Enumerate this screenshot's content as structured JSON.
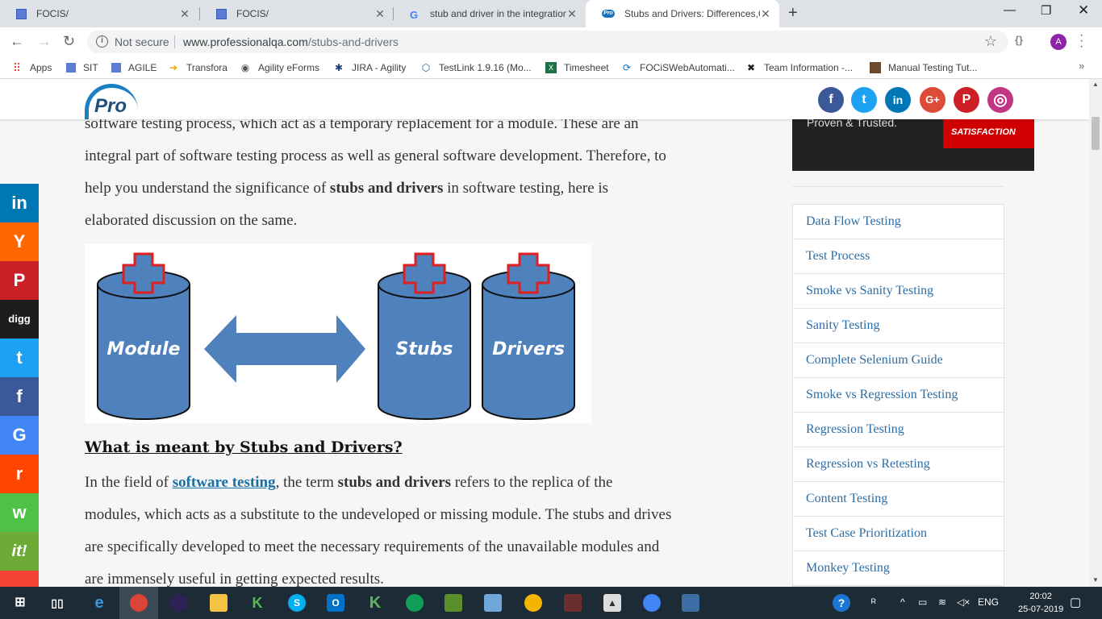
{
  "browser": {
    "tabs": [
      {
        "title": "FOCIS/",
        "icon": "doc-icon"
      },
      {
        "title": "FOCIS/",
        "icon": "doc-icon"
      },
      {
        "title": "stub and driver in the integration",
        "icon": "google-icon"
      },
      {
        "title": "Stubs and Drivers: Differences,Co",
        "icon": "pro-icon"
      }
    ],
    "address": {
      "security": "Not secure",
      "host": "www.professionalqa.com",
      "path": "/stubs-and-drivers"
    },
    "profile_initial": "A",
    "bookmarks": [
      {
        "label": "Apps",
        "icon": "apps-grid-icon",
        "color": "#e8453c"
      },
      {
        "label": "SIT",
        "icon": "doc-icon",
        "color": "#5b7bd5"
      },
      {
        "label": "AGILE",
        "icon": "doc-icon",
        "color": "#5b7bd5"
      },
      {
        "label": "Transfora",
        "icon": "transfora-icon",
        "color": "#f2a900"
      },
      {
        "label": "Agility eForms",
        "icon": "globe-icon",
        "color": "#555555"
      },
      {
        "label": "JIRA - Agility",
        "icon": "jira-icon",
        "color": "#1d3f72"
      },
      {
        "label": "TestLink 1.9.16 (Mo...",
        "icon": "testlink-icon",
        "color": "#2b5797"
      },
      {
        "label": "Timesheet",
        "icon": "sheet-icon",
        "color": "#1e7145"
      },
      {
        "label": "FOCiSWebAutomati...",
        "icon": "sync-icon",
        "color": "#0078d7"
      },
      {
        "label": "Team Information -...",
        "icon": "x-icon",
        "color": "#222222"
      },
      {
        "label": "Manual Testing Tut...",
        "icon": "cube-icon",
        "color": "#6b4a2b"
      }
    ]
  },
  "page": {
    "para1_line1": "software testing process, which act as a temporary replacement for a module. These are an",
    "para1_line2": "integral part of software testing process as well as general software development. Therefore, to",
    "para1_line3_pre": "help you understand the significance of ",
    "para1_line3_bold": "stubs and drivers",
    "para1_line3_post": " in software testing, here is",
    "para1_line4": "elaborated discussion on the same.",
    "figure": {
      "module_label": "Module",
      "stubs_label": "Stubs",
      "drivers_label": "Drivers"
    },
    "heading": "What is meant by Stubs and Drivers?",
    "para2_line1_pre": "In the field of ",
    "para2_line1_link": "software testing",
    "para2_line1_mid": ", the term ",
    "para2_line1_bold": "stubs and drivers",
    "para2_line1_post": " refers to the replica of the",
    "para2_line2": "modules, which acts as a substitute to the undeveloped or missing module. The stubs and drives",
    "para2_line3": "are specifically developed to meet the necessary requirements of the unavailable modules and",
    "para2_line4": "are immensely useful in getting expected results."
  },
  "header": {
    "logo_text": "Pro",
    "social": [
      {
        "icon": "facebook-icon",
        "glyph": "f",
        "color": "#3b5998"
      },
      {
        "icon": "twitter-icon",
        "glyph": "t",
        "color": "#1da1f2"
      },
      {
        "icon": "linkedin-icon",
        "glyph": "in",
        "color": "#0077b5"
      },
      {
        "icon": "google-plus-icon",
        "glyph": "G+",
        "color": "#dd4b39"
      },
      {
        "icon": "pinterest-icon",
        "glyph": "P",
        "color": "#cb2027"
      },
      {
        "icon": "instagram-icon",
        "glyph": "◎",
        "color": "#c13584"
      }
    ]
  },
  "ad": {
    "text": "Proven & Trusted.",
    "badge": "SATISFACTION"
  },
  "sidebar": {
    "links": [
      "Data Flow Testing",
      "Test Process",
      "Smoke vs Sanity Testing",
      "Sanity Testing",
      "Complete Selenium Guide",
      "Smoke vs Regression Testing",
      "Regression Testing",
      "Regression vs Retesting",
      "Content Testing",
      "Test Case Prioritization",
      "Monkey Testing"
    ]
  },
  "share_rail": [
    {
      "icon": "linkedin-icon",
      "glyph": "in",
      "color": "#0077b5"
    },
    {
      "icon": "hacker-news-icon",
      "glyph": "Y",
      "color": "#ff6600"
    },
    {
      "icon": "pinterest-icon",
      "glyph": "P",
      "color": "#cb2027"
    },
    {
      "icon": "digg-icon",
      "glyph": "digg",
      "color": "#1d1d1b"
    },
    {
      "icon": "twitter-icon",
      "glyph": "t",
      "color": "#1da1f2"
    },
    {
      "icon": "facebook-icon",
      "glyph": "f",
      "color": "#3b5998"
    },
    {
      "icon": "google-icon",
      "glyph": "G",
      "color": "#4285f4"
    },
    {
      "icon": "reddit-icon",
      "glyph": "r",
      "color": "#ff4500"
    },
    {
      "icon": "whatsapp-icon",
      "glyph": "w",
      "color": "#4dc247"
    },
    {
      "icon": "scoopit-icon",
      "glyph": "it!",
      "color": "#6cab36"
    },
    {
      "icon": "more-icon",
      "glyph": "",
      "color": "#f44336"
    }
  ],
  "taskbar": {
    "language": "ENG",
    "time": "20:02",
    "date": "25-07-2019"
  }
}
